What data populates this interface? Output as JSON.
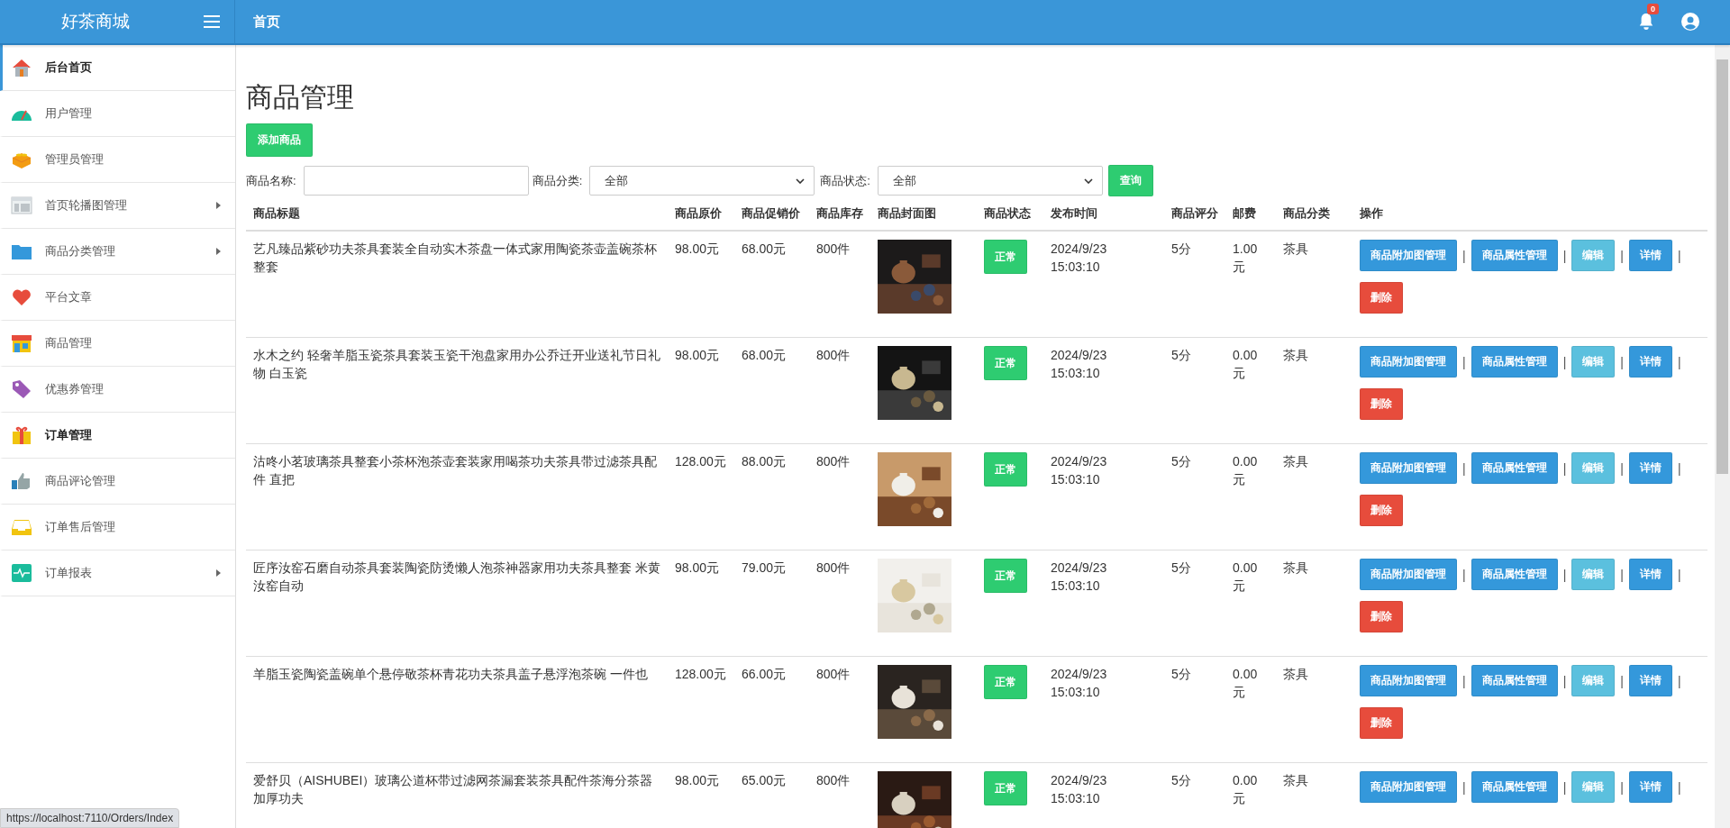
{
  "brand": "好茶商城",
  "topbar": {
    "title": "首页",
    "notification_count": "0"
  },
  "sidebar": {
    "items": [
      {
        "label": "后台首页",
        "selected": true,
        "emphasized": true,
        "has_submenu": false
      },
      {
        "label": "用户管理",
        "selected": false,
        "emphasized": false,
        "has_submenu": false
      },
      {
        "label": "管理员管理",
        "selected": false,
        "emphasized": false,
        "has_submenu": false
      },
      {
        "label": "首页轮播图管理",
        "selected": false,
        "emphasized": false,
        "has_submenu": true
      },
      {
        "label": "商品分类管理",
        "selected": false,
        "emphasized": false,
        "has_submenu": true
      },
      {
        "label": "平台文章",
        "selected": false,
        "emphasized": false,
        "has_submenu": false
      },
      {
        "label": "商品管理",
        "selected": false,
        "emphasized": false,
        "has_submenu": false
      },
      {
        "label": "优惠券管理",
        "selected": false,
        "emphasized": false,
        "has_submenu": false
      },
      {
        "label": "订单管理",
        "selected": false,
        "emphasized": true,
        "has_submenu": false
      },
      {
        "label": "商品评论管理",
        "selected": false,
        "emphasized": false,
        "has_submenu": false
      },
      {
        "label": "订单售后管理",
        "selected": false,
        "emphasized": false,
        "has_submenu": false
      },
      {
        "label": "订单报表",
        "selected": false,
        "emphasized": false,
        "has_submenu": true
      }
    ]
  },
  "page_title": "商品管理",
  "add_button": "添加商品",
  "filters": {
    "name_label": "商品名称:",
    "category_label": "商品分类:",
    "category_value": "全部",
    "status_label": "商品状态:",
    "status_value": "全部",
    "search_button": "查询"
  },
  "table": {
    "columns": [
      "商品标题",
      "商品原价",
      "商品促销价",
      "商品库存",
      "商品封面图",
      "商品状态",
      "发布时间",
      "商品评分",
      "邮费",
      "商品分类",
      "操作"
    ],
    "rows": [
      {
        "title": "艺凡臻品紫砂功夫茶具套装全自动实木茶盘一体式家用陶瓷茶壶盖碗茶杯整套",
        "price": "98.00元",
        "sale_price": "68.00元",
        "stock": "800件",
        "status": "正常",
        "published": "2024/9/23 15:03:10",
        "rating": "5分",
        "postage": "1.00元",
        "category": "茶具",
        "separator": "|",
        "actions": [
          {
            "label": "商品附加图管理",
            "kind": "primary"
          },
          {
            "label": "商品属性管理",
            "kind": "primary"
          },
          {
            "label": "编辑",
            "kind": "info"
          },
          {
            "label": "详情",
            "kind": "primary"
          },
          {
            "label": "删除",
            "kind": "danger"
          }
        ]
      },
      {
        "title": "水木之约 轻奢羊脂玉瓷茶具套装玉瓷干泡盘家用办公乔迁开业送礼节日礼物 白玉瓷",
        "price": "98.00元",
        "sale_price": "68.00元",
        "stock": "800件",
        "status": "正常",
        "published": "2024/9/23 15:03:10",
        "rating": "5分",
        "postage": "0.00元",
        "category": "茶具",
        "separator": "|",
        "actions": [
          {
            "label": "商品附加图管理",
            "kind": "primary"
          },
          {
            "label": "商品属性管理",
            "kind": "primary"
          },
          {
            "label": "编辑",
            "kind": "info"
          },
          {
            "label": "详情",
            "kind": "primary"
          },
          {
            "label": "删除",
            "kind": "danger"
          }
        ]
      },
      {
        "title": "沽咚小茗玻璃茶具整套小茶杯泡茶壶套装家用喝茶功夫茶具带过滤茶具配件 直把",
        "price": "128.00元",
        "sale_price": "88.00元",
        "stock": "800件",
        "status": "正常",
        "published": "2024/9/23 15:03:10",
        "rating": "5分",
        "postage": "0.00元",
        "category": "茶具",
        "separator": "|",
        "actions": [
          {
            "label": "商品附加图管理",
            "kind": "primary"
          },
          {
            "label": "商品属性管理",
            "kind": "primary"
          },
          {
            "label": "编辑",
            "kind": "info"
          },
          {
            "label": "详情",
            "kind": "primary"
          },
          {
            "label": "删除",
            "kind": "danger"
          }
        ]
      },
      {
        "title": "匠序汝窑石磨自动茶具套装陶瓷防烫懒人泡茶神器家用功夫茶具整套 米黄汝窑自动",
        "price": "98.00元",
        "sale_price": "79.00元",
        "stock": "800件",
        "status": "正常",
        "published": "2024/9/23 15:03:10",
        "rating": "5分",
        "postage": "0.00元",
        "category": "茶具",
        "separator": "|",
        "actions": [
          {
            "label": "商品附加图管理",
            "kind": "primary"
          },
          {
            "label": "商品属性管理",
            "kind": "primary"
          },
          {
            "label": "编辑",
            "kind": "info"
          },
          {
            "label": "详情",
            "kind": "primary"
          },
          {
            "label": "删除",
            "kind": "danger"
          }
        ]
      },
      {
        "title": "羊脂玉瓷陶瓷盖碗单个悬停敬茶杯青花功夫茶具盖子悬浮泡茶碗 一件也",
        "price": "128.00元",
        "sale_price": "66.00元",
        "stock": "800件",
        "status": "正常",
        "published": "2024/9/23 15:03:10",
        "rating": "5分",
        "postage": "0.00元",
        "category": "茶具",
        "separator": "|",
        "actions": [
          {
            "label": "商品附加图管理",
            "kind": "primary"
          },
          {
            "label": "商品属性管理",
            "kind": "primary"
          },
          {
            "label": "编辑",
            "kind": "info"
          },
          {
            "label": "详情",
            "kind": "primary"
          },
          {
            "label": "删除",
            "kind": "danger"
          }
        ]
      },
      {
        "title": "爱舒贝（AISHUBEI）玻璃公道杯带过滤网茶漏套装茶具配件茶海分茶器加厚功夫",
        "price": "98.00元",
        "sale_price": "65.00元",
        "stock": "800件",
        "status": "正常",
        "published": "2024/9/23 15:03:10",
        "rating": "5分",
        "postage": "0.00元",
        "category": "茶具",
        "separator": "|",
        "actions": [
          {
            "label": "商品附加图管理",
            "kind": "primary"
          },
          {
            "label": "商品属性管理",
            "kind": "primary"
          },
          {
            "label": "编辑",
            "kind": "info"
          },
          {
            "label": "详情",
            "kind": "primary"
          }
        ]
      }
    ]
  },
  "status_url": "https://localhost:7110/Orders/Index"
}
